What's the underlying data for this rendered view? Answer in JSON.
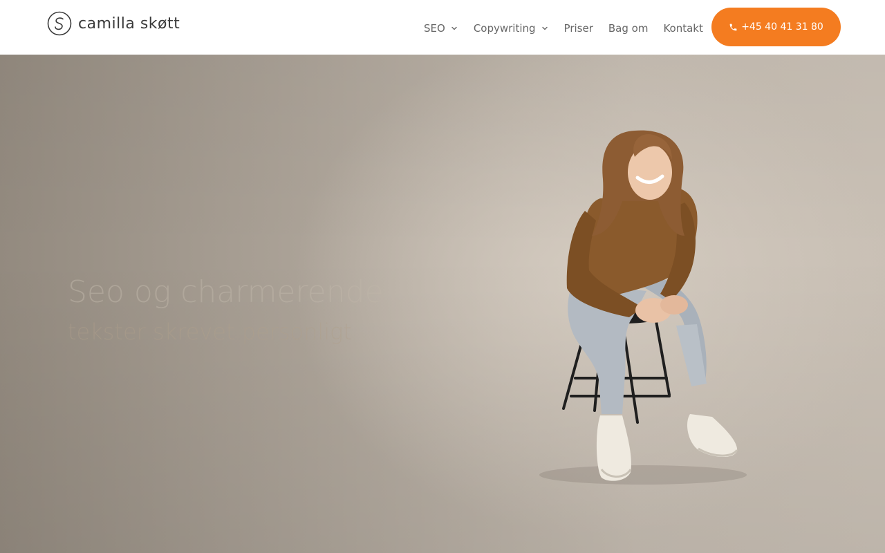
{
  "brand": {
    "name": "camilla skøtt",
    "logo_icon": "spiral-s-icon"
  },
  "nav": {
    "items": [
      {
        "label": "SEO",
        "has_dropdown": true,
        "dropdown_icon": "chevron-down-icon"
      },
      {
        "label": "Copywriting",
        "has_dropdown": true,
        "dropdown_icon": "chevron-down-icon"
      },
      {
        "label": "Priser",
        "has_dropdown": false
      },
      {
        "label": "Bag om",
        "has_dropdown": false
      },
      {
        "label": "Kontakt",
        "has_dropdown": false
      }
    ]
  },
  "cta": {
    "phone": "+45 40 41 31 80",
    "icon": "phone-icon"
  },
  "hero": {
    "headline": "Seo og charmerende",
    "subline": "tekster skrevet personligt",
    "image": "woman-sitting-on-stool-photo"
  },
  "colors": {
    "accent": "#f47c20",
    "nav_text": "#666666",
    "logo_text": "#3a3a3a",
    "hero_background": "#bfb6ab"
  }
}
